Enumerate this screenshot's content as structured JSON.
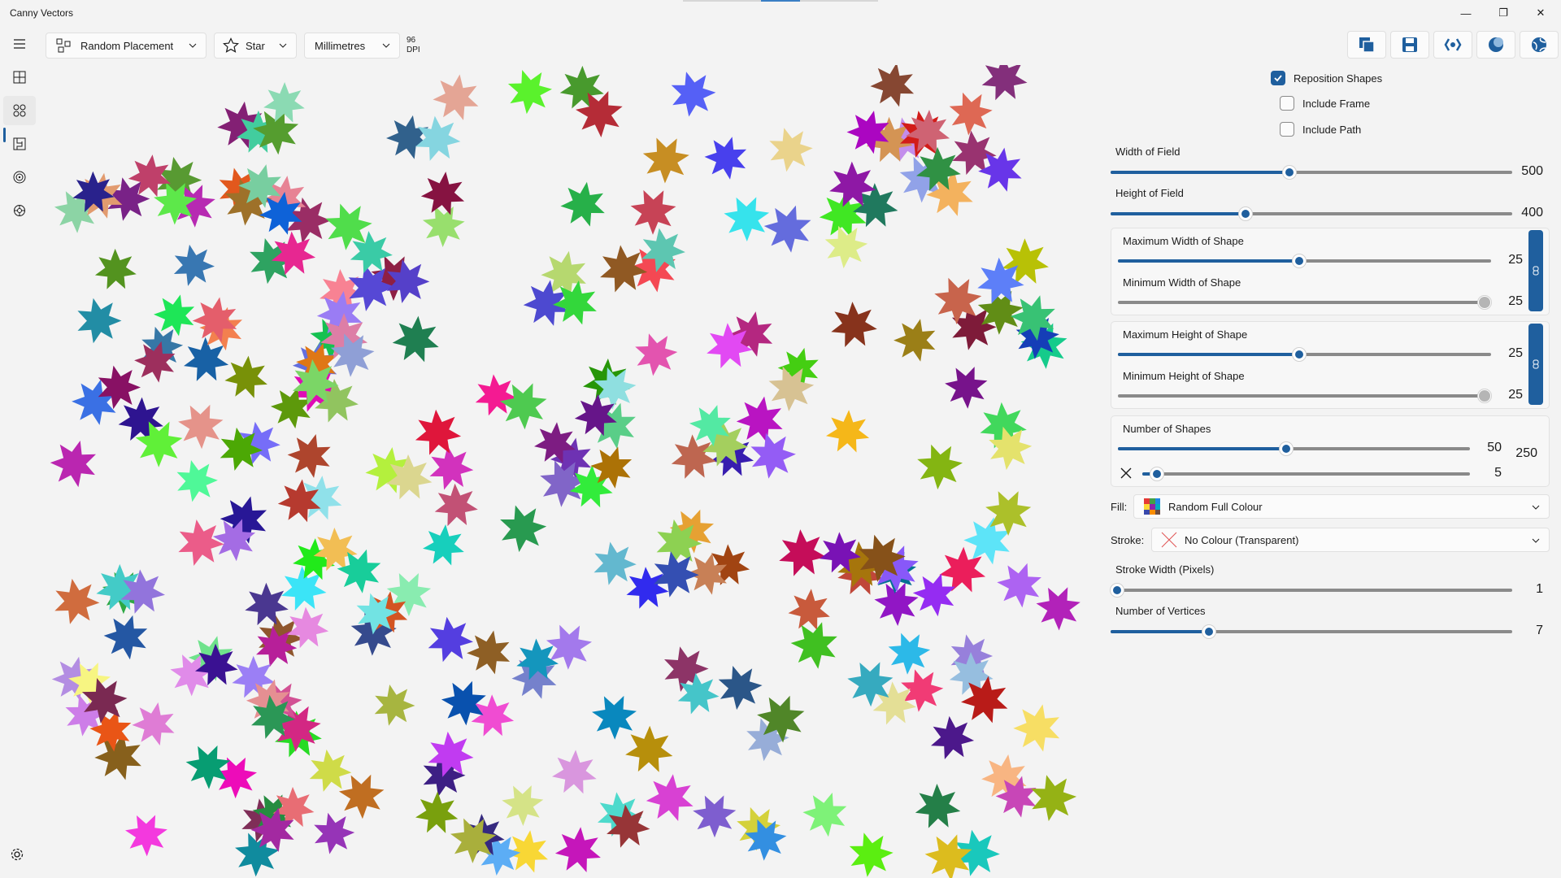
{
  "app": {
    "title": "Canny Vectors"
  },
  "window": {
    "minimize": "—",
    "restore": "❐",
    "close": "✕"
  },
  "toolbar": {
    "placement": "Random Placement",
    "shape": "Star",
    "units": "Millimetres",
    "dpi_value": "96",
    "dpi_label": "DPI"
  },
  "options": {
    "reposition_shapes": {
      "label": "Reposition Shapes",
      "checked": true
    },
    "include_frame": {
      "label": "Include Frame",
      "checked": false
    },
    "include_path": {
      "label": "Include Path",
      "checked": false
    }
  },
  "sliders": {
    "width_field": {
      "label": "Width of Field",
      "value": "500"
    },
    "height_field": {
      "label": "Height of Field",
      "value": "400"
    },
    "max_width": {
      "label": "Maximum Width of Shape",
      "value": "25"
    },
    "min_width": {
      "label": "Minimum Width of Shape",
      "value": "25"
    },
    "max_height": {
      "label": "Maximum Height of Shape",
      "value": "25"
    },
    "min_height": {
      "label": "Minimum Height of Shape",
      "value": "25"
    },
    "num_shapes": {
      "label": "Number of Shapes",
      "value": "50",
      "max": "250"
    },
    "num_shapes_secondary": {
      "value": "5"
    },
    "stroke_width": {
      "label": "Stroke Width (Pixels)",
      "value": "1"
    },
    "vertices": {
      "label": "Number of Vertices",
      "value": "7"
    }
  },
  "fill": {
    "label": "Fill:",
    "value": "Random Full Colour"
  },
  "stroke": {
    "label": "Stroke:",
    "value": "No Colour (Transparent)"
  },
  "colors": {
    "accent": "#1f5f9e",
    "background": "#f3f3f3"
  }
}
